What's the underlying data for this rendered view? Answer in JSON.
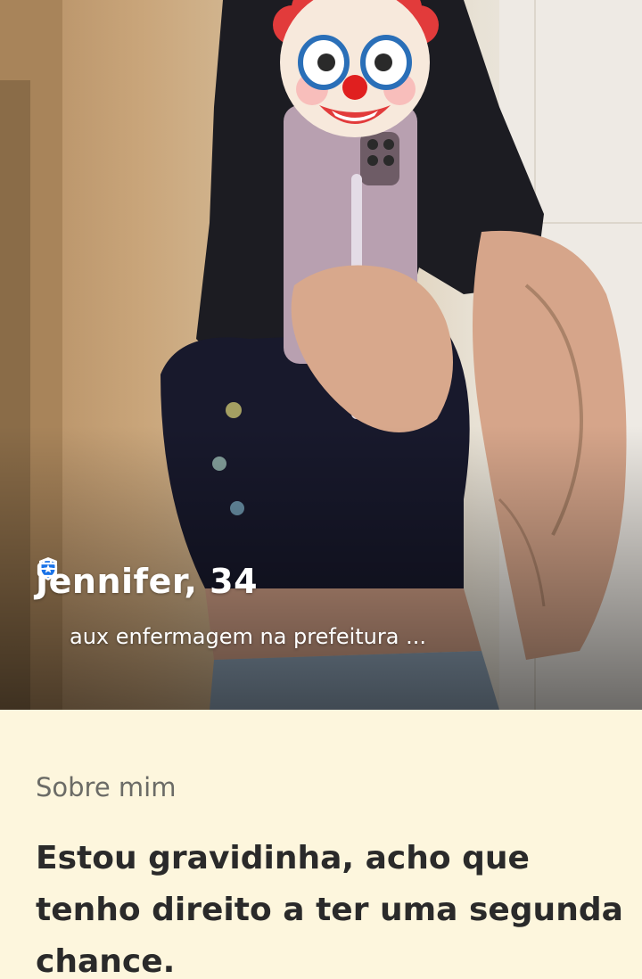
{
  "profile": {
    "name_age": "Jennifer, 34",
    "job": "aux enfermagem na prefeitura ...",
    "verified_icon": "verified-badge-icon",
    "job_icon": "briefcase-icon",
    "photo_overlay_icon": "clown-face-emoji"
  },
  "about": {
    "heading": "Sobre mim",
    "text": "Estou gravidinha, acho que tenho direito a ter uma segunda chance."
  },
  "colors": {
    "panel_background": "#fdf6dd",
    "verified_badge": "#1a73e8",
    "heading_text": "#6b6b66",
    "body_text": "#2a2a2a"
  }
}
